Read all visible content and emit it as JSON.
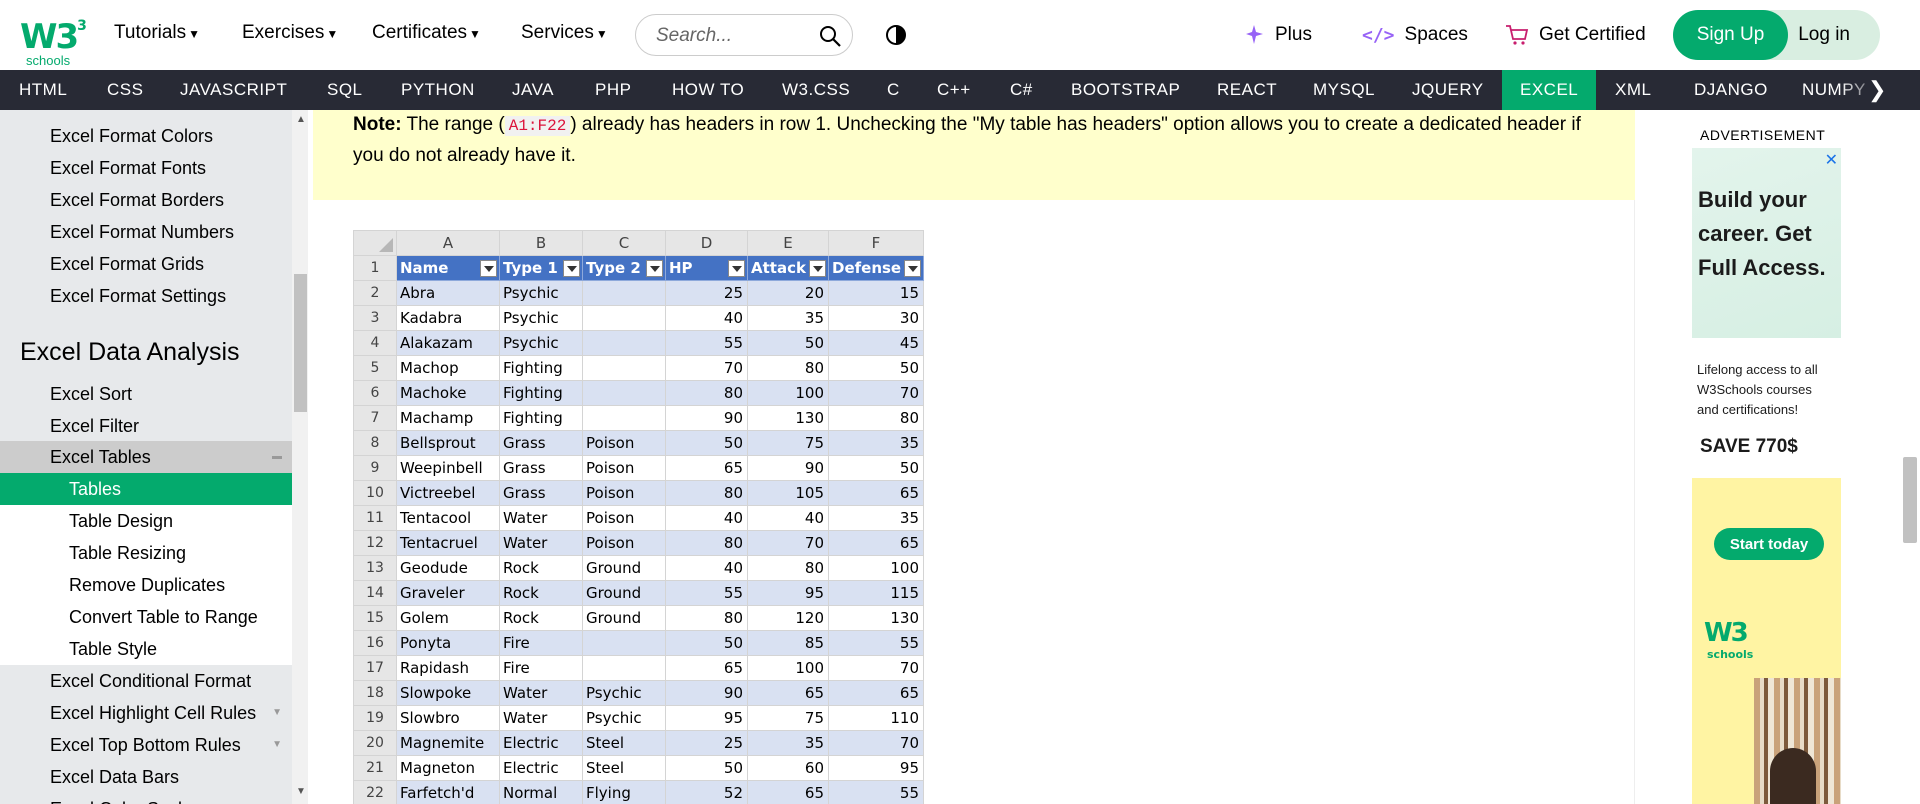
{
  "brand": {
    "logo_text": "W3",
    "logo_sup": "3",
    "logo_sub": "schools"
  },
  "topnav": {
    "menus": [
      "Tutorials",
      "Exercises",
      "Certificates",
      "Services"
    ],
    "search_placeholder": "Search...",
    "plus": "Plus",
    "spaces": "Spaces",
    "get_certified": "Get Certified",
    "signup": "Sign Up",
    "login": "Log in"
  },
  "langbar": {
    "items": [
      "HTML",
      "CSS",
      "JAVASCRIPT",
      "SQL",
      "PYTHON",
      "JAVA",
      "PHP",
      "HOW TO",
      "W3.CSS",
      "C",
      "C++",
      "C#",
      "BOOTSTRAP",
      "REACT",
      "MYSQL",
      "JQUERY",
      "EXCEL",
      "XML",
      "DJANGO",
      "NUMPY"
    ],
    "active": "EXCEL",
    "next_glyph": "❯"
  },
  "sidebar": {
    "items_top": [
      "Excel Format Colors",
      "Excel Format Fonts",
      "Excel Format Borders",
      "Excel Format Numbers",
      "Excel Format Grids",
      "Excel Format Settings"
    ],
    "heading": "Excel Data Analysis",
    "items_mid": [
      "Excel Sort",
      "Excel Filter"
    ],
    "expanded": "Excel Tables",
    "subitems": [
      "Tables",
      "Table Design",
      "Table Resizing",
      "Remove Duplicates",
      "Convert Table to Range",
      "Table Style"
    ],
    "current": "Tables",
    "items_bottom": [
      "Excel Conditional Format",
      "Excel Highlight Cell Rules",
      "Excel Top Bottom Rules",
      "Excel Data Bars",
      "Excel Color Scales"
    ]
  },
  "note": {
    "label": "Note:",
    "text_before": " The range (",
    "code": "A1:F22",
    "text_after": ") already has headers in row 1. Unchecking the \"My table has headers\" option allows you to create a dedicated header if you do not already have it."
  },
  "sheet": {
    "columns": [
      "A",
      "B",
      "C",
      "D",
      "E",
      "F"
    ],
    "headers": [
      "Name",
      "Type 1",
      "Type 2",
      "HP",
      "Attack",
      "Defense"
    ],
    "rows": [
      [
        "Abra",
        "Psychic",
        "",
        "25",
        "20",
        "15"
      ],
      [
        "Kadabra",
        "Psychic",
        "",
        "40",
        "35",
        "30"
      ],
      [
        "Alakazam",
        "Psychic",
        "",
        "55",
        "50",
        "45"
      ],
      [
        "Machop",
        "Fighting",
        "",
        "70",
        "80",
        "50"
      ],
      [
        "Machoke",
        "Fighting",
        "",
        "80",
        "100",
        "70"
      ],
      [
        "Machamp",
        "Fighting",
        "",
        "90",
        "130",
        "80"
      ],
      [
        "Bellsprout",
        "Grass",
        "Poison",
        "50",
        "75",
        "35"
      ],
      [
        "Weepinbell",
        "Grass",
        "Poison",
        "65",
        "90",
        "50"
      ],
      [
        "Victreebel",
        "Grass",
        "Poison",
        "80",
        "105",
        "65"
      ],
      [
        "Tentacool",
        "Water",
        "Poison",
        "40",
        "40",
        "35"
      ],
      [
        "Tentacruel",
        "Water",
        "Poison",
        "80",
        "70",
        "65"
      ],
      [
        "Geodude",
        "Rock",
        "Ground",
        "40",
        "80",
        "100"
      ],
      [
        "Graveler",
        "Rock",
        "Ground",
        "55",
        "95",
        "115"
      ],
      [
        "Golem",
        "Rock",
        "Ground",
        "80",
        "120",
        "130"
      ],
      [
        "Ponyta",
        "Fire",
        "",
        "50",
        "85",
        "55"
      ],
      [
        "Rapidash",
        "Fire",
        "",
        "65",
        "100",
        "70"
      ],
      [
        "Slowpoke",
        "Water",
        "Psychic",
        "90",
        "65",
        "65"
      ],
      [
        "Slowbro",
        "Water",
        "Psychic",
        "95",
        "75",
        "110"
      ],
      [
        "Magnemite",
        "Electric",
        "Steel",
        "25",
        "35",
        "70"
      ],
      [
        "Magneton",
        "Electric",
        "Steel",
        "50",
        "60",
        "95"
      ],
      [
        "Farfetch'd",
        "Normal",
        "Flying",
        "52",
        "65",
        "55"
      ]
    ]
  },
  "ad": {
    "label": "ADVERTISEMENT",
    "headline": "Build your career. Get Full Access.",
    "sub": "Lifelong access to all W3Schools courses and certifications!",
    "save": "SAVE 770$",
    "cta": "Start today",
    "logo_text": "W3",
    "logo_sub": "schools"
  },
  "colors": {
    "accent": "#04AA6D",
    "langbar": "#282A35",
    "note_bg": "#FFFFCC",
    "table_header": "#4472C4",
    "table_band": "#D9E1F2"
  }
}
